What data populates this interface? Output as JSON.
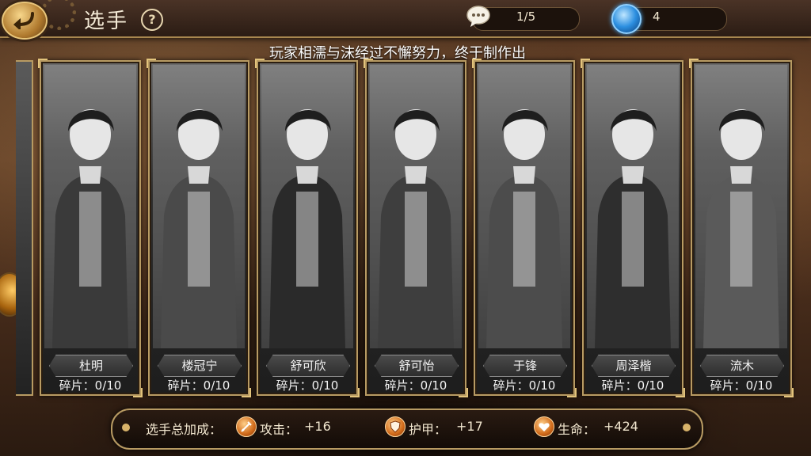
{
  "header": {
    "title": "选手",
    "help_icon": "question-icon",
    "messages": {
      "icon": "chat-bubble-icon",
      "value": "1/5"
    },
    "gems": {
      "icon": "blue-gem-icon",
      "value": "4"
    }
  },
  "ticker": {
    "text": "玩家相濡与沫经过不懈努力，终于制作出"
  },
  "players": [
    {
      "name": "杜明",
      "shards": "碎片：0/10"
    },
    {
      "name": "楼冠宁",
      "shards": "碎片：0/10"
    },
    {
      "name": "舒可欣",
      "shards": "碎片：0/10"
    },
    {
      "name": "舒可怡",
      "shards": "碎片：0/10"
    },
    {
      "name": "于锋",
      "shards": "碎片：0/10"
    },
    {
      "name": "周泽楷",
      "shards": "碎片：0/10"
    },
    {
      "name": "流木",
      "shards": "碎片：0/10"
    }
  ],
  "bonus": {
    "label": "选手总加成：",
    "attack": {
      "icon": "sword-icon",
      "label": "攻击：",
      "value": "+16"
    },
    "armor": {
      "icon": "shield-icon",
      "label": "护甲：",
      "value": "+17"
    },
    "life": {
      "icon": "heart-icon",
      "label": "生命：",
      "value": "+424"
    }
  }
}
